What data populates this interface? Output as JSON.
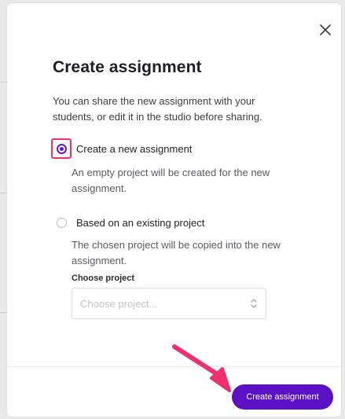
{
  "modal": {
    "title": "Create assignment",
    "description": "You can share the new assignment with your students, or edit it in the studio before sharing.",
    "close_icon": "close-icon"
  },
  "options": [
    {
      "label": "Create a new assignment",
      "help": "An empty project will be created for the new assignment.",
      "selected": true
    },
    {
      "label": "Based on an existing project",
      "help": "The chosen project will be copied into the new assignment.",
      "selected": false
    }
  ],
  "choose_project": {
    "label": "Choose project",
    "placeholder": "Choose project...",
    "icon": "select-arrows-icon"
  },
  "footer": {
    "create_label": "Create assignment"
  },
  "colors": {
    "accent": "#5b12c7",
    "highlight": "#f0306e"
  }
}
